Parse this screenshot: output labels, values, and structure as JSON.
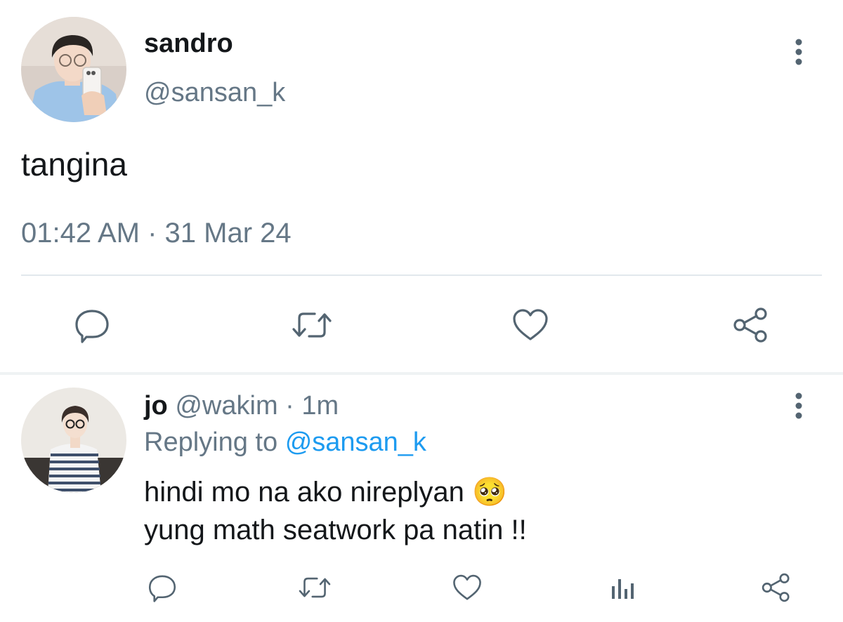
{
  "main_tweet": {
    "display_name": "sandro",
    "handle": "@sansan_k",
    "text": "tangina",
    "timestamp": "01:42 AM · 31 Mar 24",
    "actions": [
      "reply-icon",
      "retweet-icon",
      "like-icon",
      "share-icon"
    ]
  },
  "reply_tweet": {
    "display_name": "jo",
    "handle": "@wakim",
    "separator": "·",
    "age": "1m",
    "replying_label": "Replying to",
    "replying_handle": "@sansan_k",
    "line1": "hindi mo na ako nireplyan",
    "emoji": "🥺",
    "line2": "yung math seatwork pa natin !!",
    "actions": [
      "reply-icon",
      "retweet-icon",
      "like-icon",
      "analytics-icon",
      "share-icon"
    ]
  },
  "colors": {
    "text": "#14171a",
    "secondary": "#657786",
    "icon": "#536471",
    "link": "#1d9bf0",
    "divider": "#e1e8ed",
    "separator_band": "#eff3f4"
  }
}
